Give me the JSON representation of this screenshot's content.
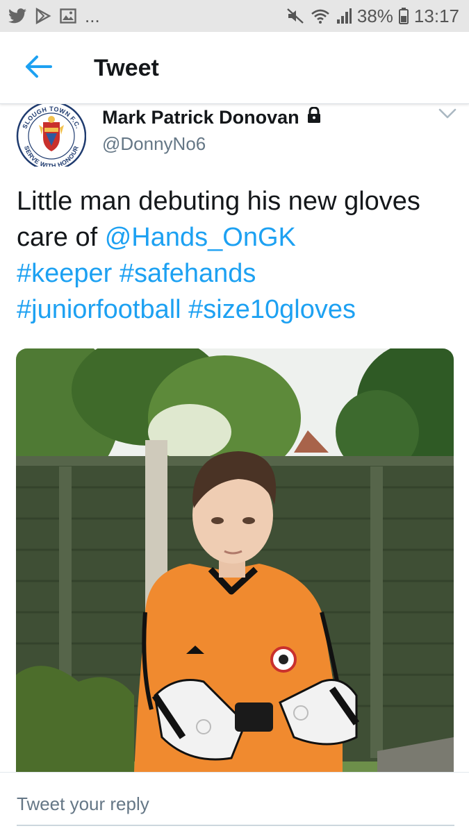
{
  "status_bar": {
    "notification_icons": [
      "twitter-icon",
      "play-store-icon",
      "image-icon"
    ],
    "more": "...",
    "battery": "38%",
    "time": "13:17"
  },
  "top_bar": {
    "back_icon": "arrow-left-icon",
    "title": "Tweet"
  },
  "tweet": {
    "author_name": "Mark Patrick Donovan",
    "protected_icon": "lock-icon",
    "handle": "@DonnyNo6",
    "avatar_text": {
      "top": "SLOUGH TOWN F.C.",
      "bottom": "SERVE WITH HONOUR"
    },
    "text_plain_1": "Little man debuting his new gloves care of ",
    "mention": "@Hands_OnGK",
    "hashtags": [
      "#keeper",
      "#safehands",
      "#juniorfootball",
      "#size10gloves"
    ],
    "photo_alt": "Boy in orange goalkeeper kit with gloves in garden"
  },
  "reply": {
    "placeholder": "Tweet your reply"
  },
  "colors": {
    "accent": "#1da1f2",
    "text": "#14171a",
    "secondary": "#657786",
    "status_bar_bg": "#e6e6e6"
  }
}
